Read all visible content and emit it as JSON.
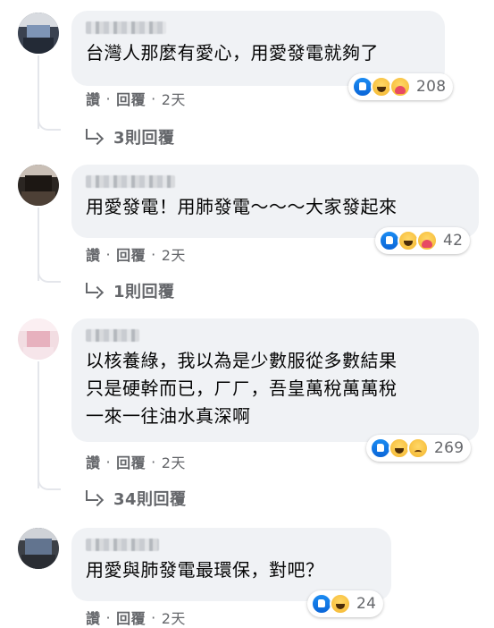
{
  "comments": [
    {
      "text": "台灣人那麼有愛心，用愛發電就夠了",
      "reaction_count": "208",
      "reactions": [
        "like-icon",
        "haha-icon",
        "care-icon"
      ],
      "meta": {
        "like": "讚",
        "reply": "回覆",
        "separator": "·",
        "time": "2天"
      },
      "replies_label": "3則回覆"
    },
    {
      "text": "用愛發電！用肺發電～～～大家發起來",
      "reaction_count": "42",
      "reactions": [
        "like-icon",
        "haha-icon",
        "care-icon"
      ],
      "meta": {
        "like": "讚",
        "reply": "回覆",
        "separator": "·",
        "time": "2天"
      },
      "replies_label": "1則回覆"
    },
    {
      "text": "以核養綠，我以為是少數服從多數結果\n只是硬幹而已，ㄏㄏ，吾皇萬稅萬萬稅\n一來一往油水真深啊",
      "reaction_count": "269",
      "reactions": [
        "like-icon",
        "haha-icon",
        "sad-icon"
      ],
      "meta": {
        "like": "讚",
        "reply": "回覆",
        "separator": "·",
        "time": "2天"
      },
      "replies_label": "34則回覆"
    },
    {
      "text": "用愛與肺發電最環保，對吧？",
      "reaction_count": "24",
      "reactions": [
        "like-icon",
        "haha-icon"
      ],
      "meta": {
        "like": "讚",
        "reply": "回覆",
        "separator": "·",
        "time": "2天"
      }
    }
  ],
  "colors": {
    "bubble": "#f0f2f5",
    "meta_text": "#65676b",
    "like_blue": "#1877f2",
    "thread_line": "#e4e6eb"
  }
}
